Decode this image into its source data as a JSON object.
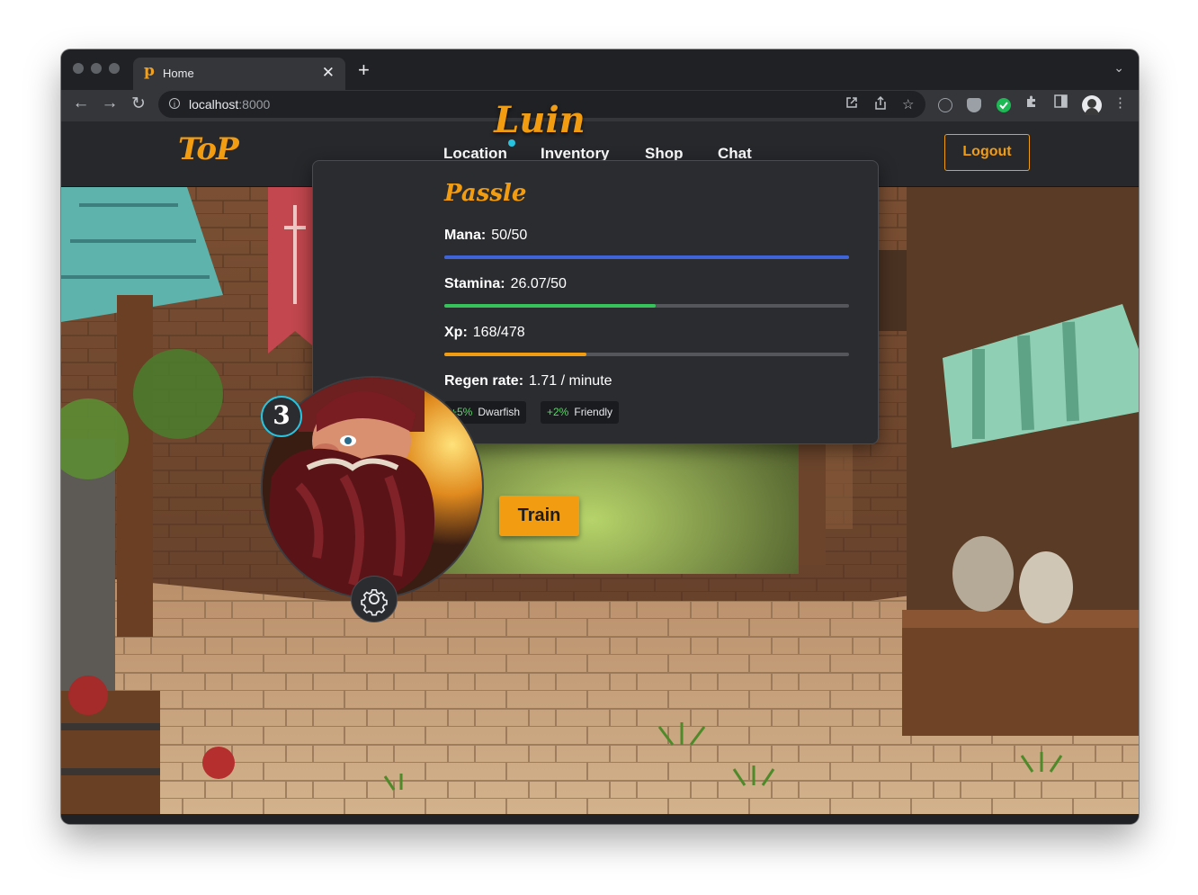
{
  "browser": {
    "tab_title": "Home",
    "tab_favicon": "p",
    "new_tab_glyph": "+",
    "url_host": "localhost",
    "url_port": ":8000"
  },
  "app": {
    "logo": "ToP",
    "nav": [
      {
        "label": "Location",
        "has_notification": true
      },
      {
        "label": "Inventory"
      },
      {
        "label": "Shop"
      },
      {
        "label": "Chat"
      }
    ],
    "logout_label": "Logout",
    "accent_color": "#f29c12",
    "notification_color": "#27c4e0"
  },
  "location": {
    "name": "Luin"
  },
  "character": {
    "name": "Passle",
    "level": "3",
    "stats": {
      "mana": {
        "label": "Mana:",
        "value": "50/50",
        "fraction": 1.0,
        "color": "#3f63d9"
      },
      "stamina": {
        "label": "Stamina:",
        "value": "26.07/50",
        "fraction": 0.5214,
        "color": "#34c45a"
      },
      "xp": {
        "label": "Xp:",
        "value": "168/478",
        "fraction": 0.3515,
        "color": "#f29c12"
      }
    },
    "regen": {
      "label": "Regen rate:",
      "value": "1.71 / minute"
    },
    "bonuses": [
      {
        "pct": "+5%",
        "name": "Dwarfish"
      },
      {
        "pct": "+2%",
        "name": "Friendly"
      }
    ]
  },
  "actions": {
    "train_label": "Train"
  }
}
